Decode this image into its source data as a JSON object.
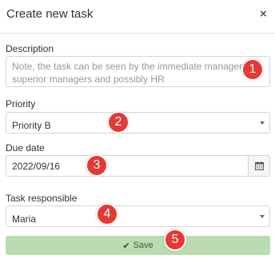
{
  "dialog": {
    "title": "Create new task",
    "close_glyph": "×"
  },
  "description": {
    "label": "Description",
    "placeholder": "Note, the task can be seen by the immediate manager, superior managers and possibly HR"
  },
  "priority": {
    "label": "Priority",
    "selected": "Priority B"
  },
  "due_date": {
    "label": "Due date",
    "value": "2022/09/16",
    "icon": "calendar-icon"
  },
  "responsible": {
    "label": "Task responsible",
    "selected": "Maria"
  },
  "save": {
    "label": "Save",
    "icon": "checkmark-icon"
  },
  "annotations": [
    "1",
    "2",
    "3",
    "4",
    "5"
  ],
  "colors": {
    "save_bg": "#b9dcb0",
    "badge": "#e53935"
  }
}
